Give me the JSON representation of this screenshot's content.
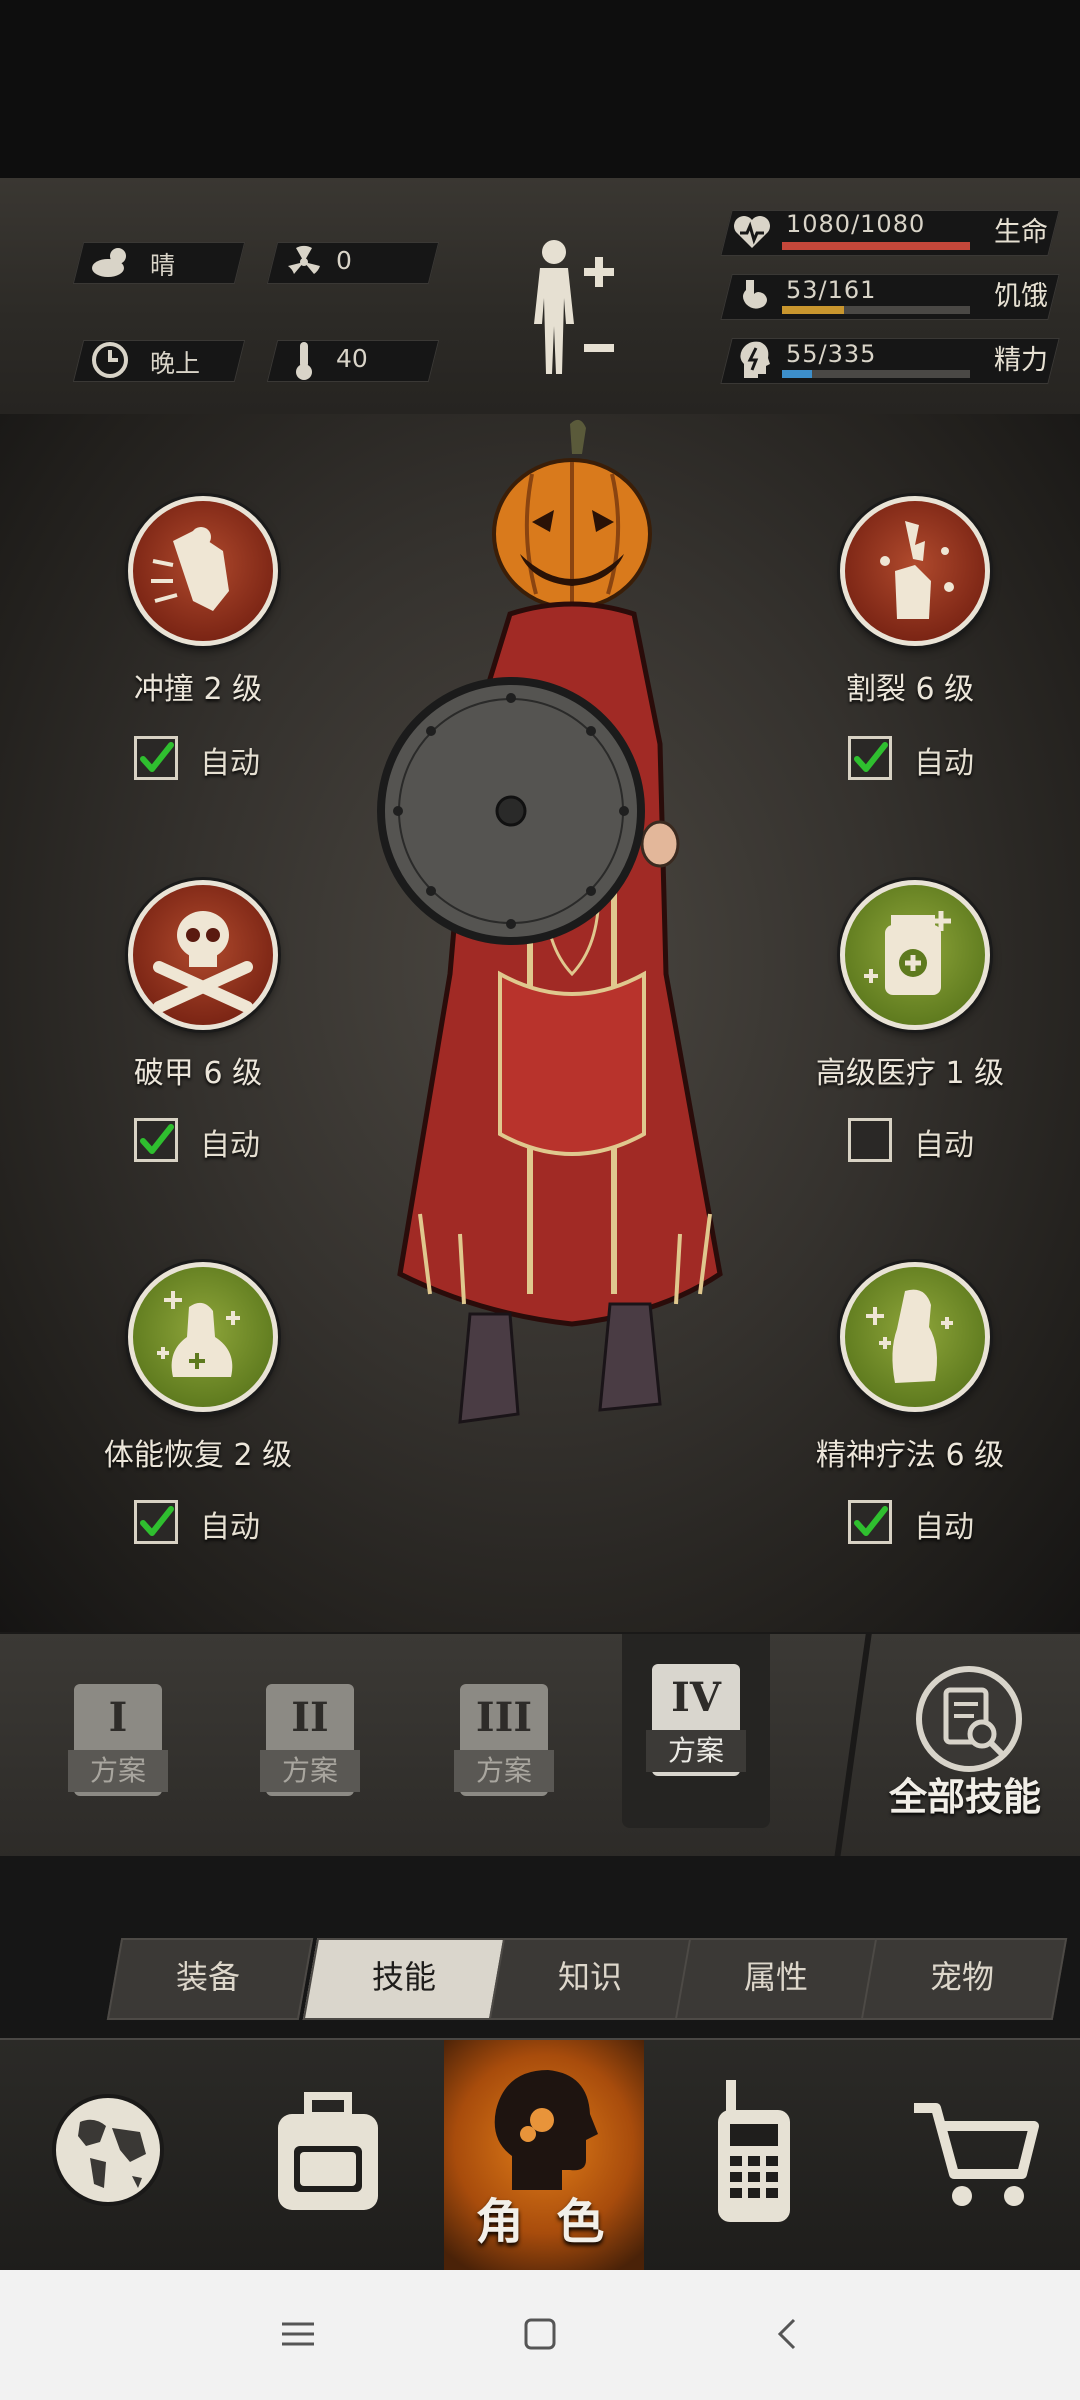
{
  "status": {
    "weather": "晴",
    "radiation": "0",
    "time_of_day": "晚上",
    "temperature": "40"
  },
  "vitals": [
    {
      "name": "生命",
      "value": "1080/1080",
      "level": 1.0,
      "color": "#c5473a"
    },
    {
      "name": "饥饿",
      "value": "53/161",
      "level": 0.33,
      "color": "#c9962e"
    },
    {
      "name": "精力",
      "value": "55/335",
      "level": 0.16,
      "color": "#3d8fcb"
    }
  ],
  "skills": [
    {
      "name": "冲撞 2 级",
      "auto_label": "自动",
      "auto_checked": true,
      "icon": "charge-icon"
    },
    {
      "name": "割裂 6 级",
      "auto_label": "自动",
      "auto_checked": true,
      "icon": "laceration-icon"
    },
    {
      "name": "破甲 6 级",
      "auto_label": "自动",
      "auto_checked": true,
      "icon": "skull-crossbones-icon"
    },
    {
      "name": "高级医疗 1 级",
      "auto_label": "自动",
      "auto_checked": false,
      "icon": "medicine-icon"
    },
    {
      "name": "体能恢复 2 级",
      "auto_label": "自动",
      "auto_checked": true,
      "icon": "stamina-recovery-icon"
    },
    {
      "name": "精神疗法 6 级",
      "auto_label": "自动",
      "auto_checked": true,
      "icon": "mental-therapy-icon"
    }
  ],
  "plans": [
    {
      "num": "I",
      "label": "方案",
      "active": false
    },
    {
      "num": "II",
      "label": "方案",
      "active": false
    },
    {
      "num": "III",
      "label": "方案",
      "active": false
    },
    {
      "num": "IV",
      "label": "方案",
      "active": true
    }
  ],
  "all_skills_label": "全部技能",
  "tabs": [
    {
      "label": "装备",
      "active": false
    },
    {
      "label": "技能",
      "active": true
    },
    {
      "label": "知识",
      "active": false
    },
    {
      "label": "属性",
      "active": false
    },
    {
      "label": "宠物",
      "active": false
    }
  ],
  "nav": {
    "center_label": "角 色",
    "items": [
      "globe-icon",
      "backpack-icon",
      "character-icon",
      "radio-icon",
      "cart-icon"
    ]
  },
  "colors": {
    "accent_orange": "#e07d18",
    "check_green": "#2fbf2f"
  }
}
